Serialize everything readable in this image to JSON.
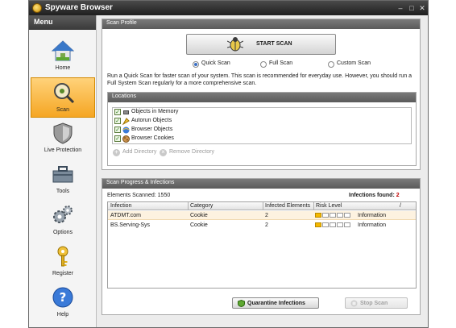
{
  "window": {
    "title": "Spyware Browser"
  },
  "sidebar": {
    "header": "Menu",
    "items": [
      {
        "label": "Home",
        "icon": "home-icon"
      },
      {
        "label": "Scan",
        "icon": "scan-icon",
        "active": true
      },
      {
        "label": "Live Protection",
        "icon": "shield-icon"
      },
      {
        "label": "Tools",
        "icon": "toolbox-icon"
      },
      {
        "label": "Options",
        "icon": "gears-icon"
      },
      {
        "label": "Register",
        "icon": "key-icon"
      },
      {
        "label": "Help",
        "icon": "help-icon"
      }
    ]
  },
  "scan_profile": {
    "header": "Scan Profile",
    "start_button": "START SCAN",
    "options": [
      {
        "label": "Quick Scan",
        "selected": true
      },
      {
        "label": "Full Scan",
        "selected": false
      },
      {
        "label": "Custom Scan",
        "selected": false
      }
    ],
    "description": "Run a Quick Scan for faster scan of your system. This scan is recommended for everyday use. However, you should run a Full System Scan regularly for a more comprehensive scan."
  },
  "locations": {
    "header": "Locations",
    "items": [
      {
        "label": "Objects in Memory",
        "checked": true
      },
      {
        "label": "Autorun Objects",
        "checked": true
      },
      {
        "label": "Browser Objects",
        "checked": true
      },
      {
        "label": "Browser Cookies",
        "checked": true
      }
    ],
    "add_button": "Add Directory",
    "remove_button": "Remove Directory"
  },
  "progress": {
    "header": "Scan Progress & Infections",
    "elements_label": "Elements Scanned:",
    "elements_value": "1550",
    "infections_label": "Infections found:",
    "infections_value": "2",
    "columns": [
      "Infection",
      "Category",
      "Infected Elements",
      "Risk Level",
      "/"
    ],
    "rows": [
      {
        "infection": "ATDMT.com",
        "category": "Cookie",
        "elements": "2",
        "risk_level": 1,
        "risk_text": "Information"
      },
      {
        "infection": "BS.Serving-Sys",
        "category": "Cookie",
        "elements": "2",
        "risk_level": 1,
        "risk_text": "Information"
      }
    ],
    "quarantine_button": "Quarantine Infections",
    "stop_button": "Stop Scan"
  },
  "colors": {
    "accent": "#f5a623",
    "danger": "#c00000",
    "header": "#5a5a5a"
  }
}
